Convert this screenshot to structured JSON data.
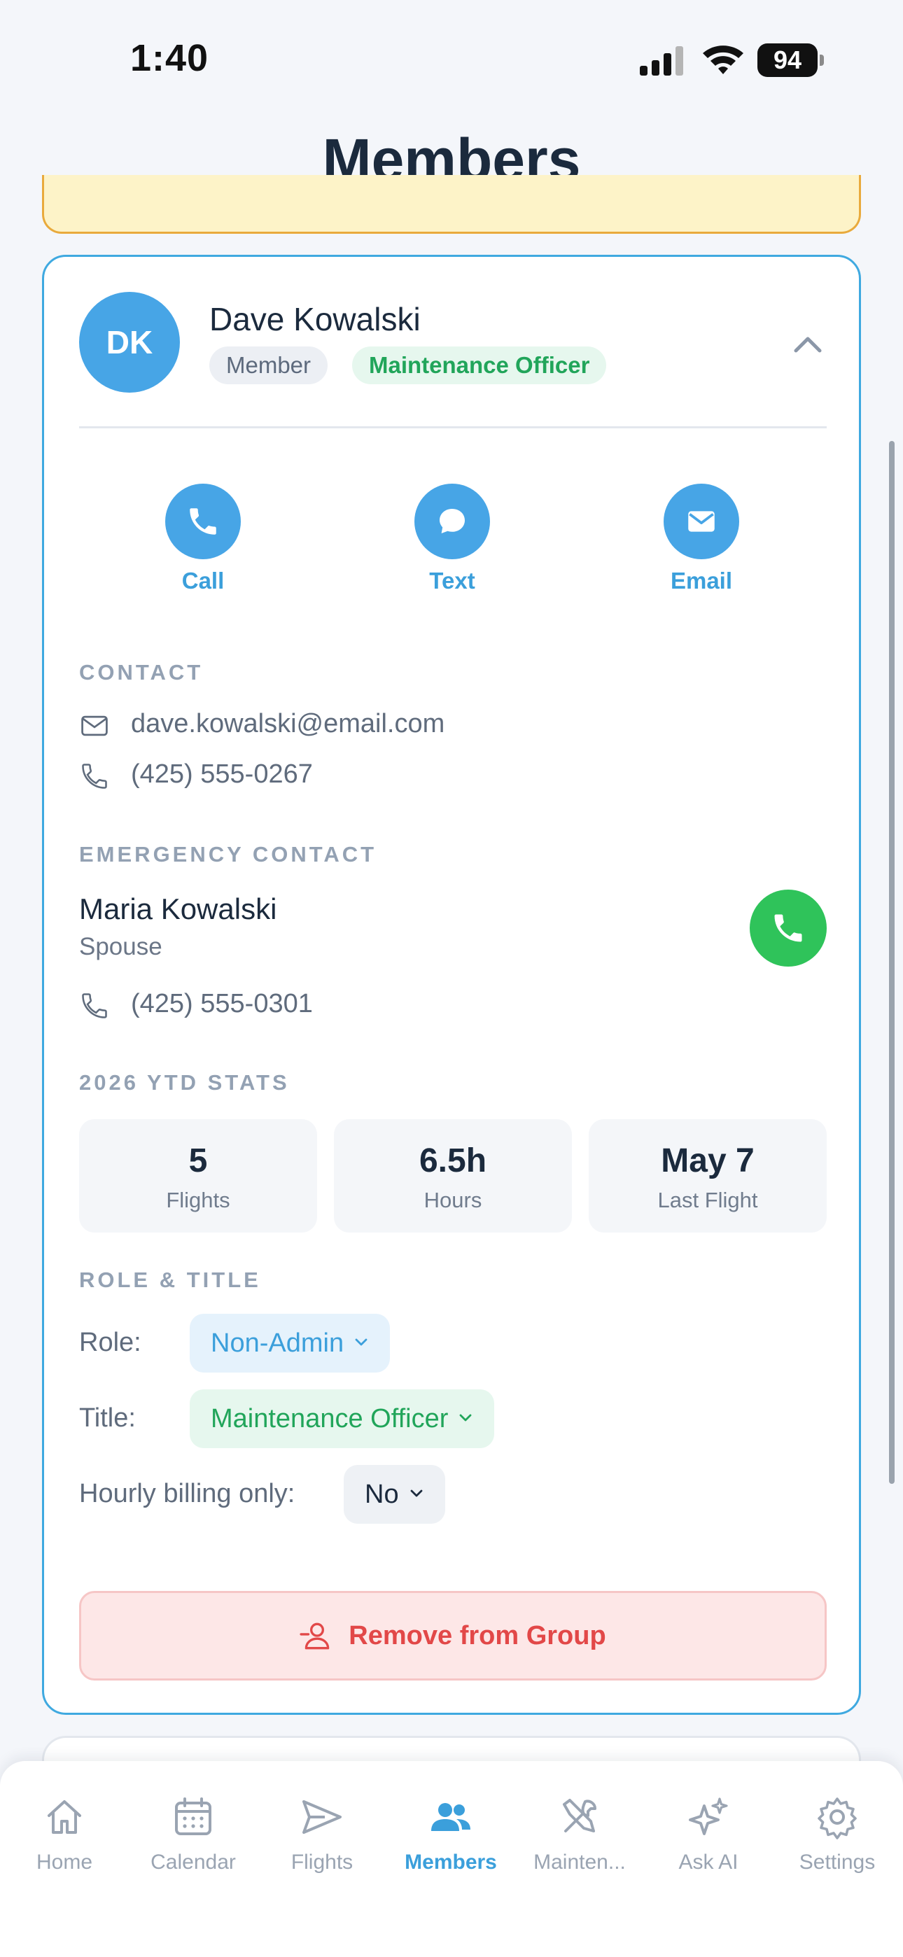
{
  "status_bar": {
    "time": "1:40",
    "battery": "94"
  },
  "header": {
    "title": "Members"
  },
  "member": {
    "initials": "DK",
    "name": "Dave Kowalski",
    "role_badge": "Member",
    "title_badge": "Maintenance Officer"
  },
  "actions": [
    {
      "label": "Call",
      "icon": "phone-icon"
    },
    {
      "label": "Text",
      "icon": "chat-bubble-icon"
    },
    {
      "label": "Email",
      "icon": "mail-icon"
    }
  ],
  "contact": {
    "section_label": "CONTACT",
    "email": "dave.kowalski@email.com",
    "phone": "(425) 555-0267"
  },
  "emergency_contact": {
    "section_label": "EMERGENCY CONTACT",
    "name": "Maria Kowalski",
    "relationship": "Spouse",
    "phone": "(425) 555-0301"
  },
  "stats": {
    "section_label": "2026 YTD STATS",
    "items": [
      {
        "value": "5",
        "label": "Flights"
      },
      {
        "value": "6.5h",
        "label": "Hours"
      },
      {
        "value": "May 7",
        "label": "Last Flight"
      }
    ]
  },
  "role_title": {
    "section_label": "ROLE & TITLE",
    "role_label": "Role:",
    "role_value": "Non-Admin",
    "title_label": "Title:",
    "title_value": "Maintenance Officer",
    "billing_label": "Hourly billing only:",
    "billing_value": "No"
  },
  "remove_button": {
    "label": "Remove from Group"
  },
  "tabbar": {
    "active": "Members",
    "tabs": [
      {
        "label": "Home",
        "icon": "home-icon"
      },
      {
        "label": "Calendar",
        "icon": "calendar-icon"
      },
      {
        "label": "Flights",
        "icon": "paper-plane-icon"
      },
      {
        "label": "Members",
        "icon": "people-icon"
      },
      {
        "label": "Mainten...",
        "icon": "tools-icon"
      },
      {
        "label": "Ask AI",
        "icon": "sparkles-icon"
      },
      {
        "label": "Settings",
        "icon": "gear-icon"
      }
    ]
  },
  "colors": {
    "accent": "#3b9fdb",
    "card_border": "#3fa9e0",
    "success": "#21a55a",
    "call_green": "#2fc35a",
    "danger": "#e24848",
    "warning_card": "#fdf3c8"
  }
}
